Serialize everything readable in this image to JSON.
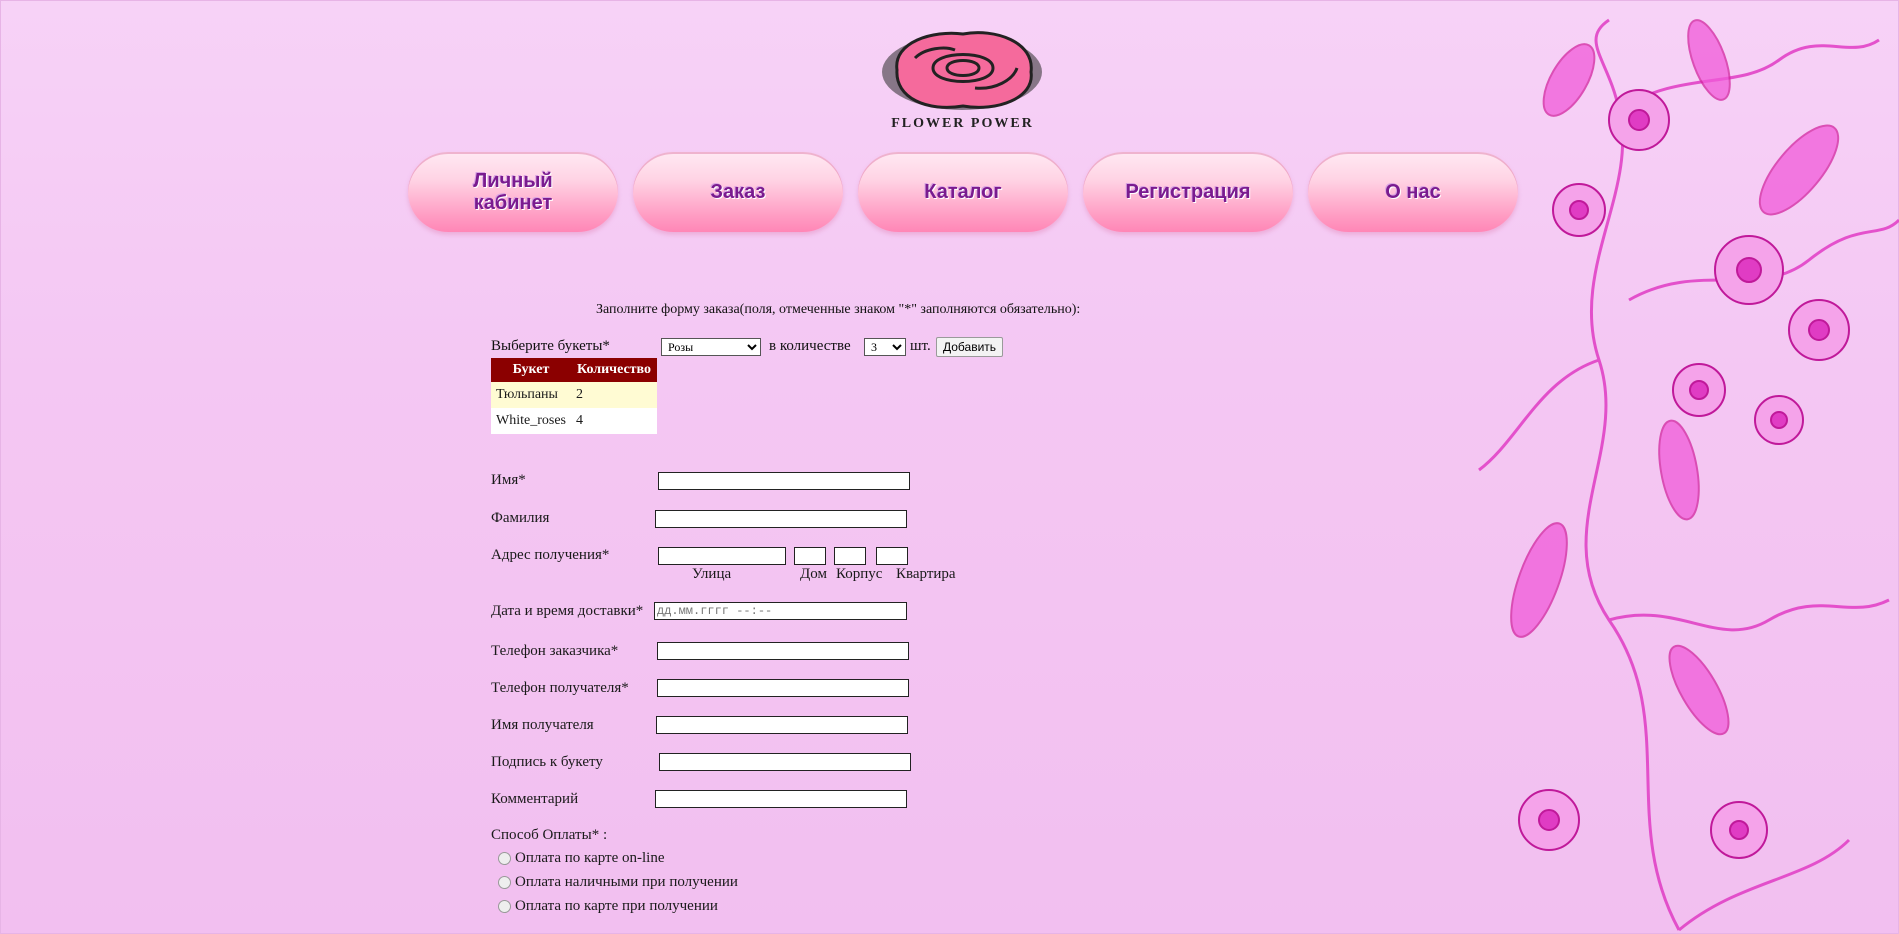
{
  "logo": {
    "text": "FLOWER POWER"
  },
  "nav": [
    {
      "label": "Личный\nкабинет"
    },
    {
      "label": "Заказ"
    },
    {
      "label": "Каталог"
    },
    {
      "label": "Регистрация"
    },
    {
      "label": "О нас"
    }
  ],
  "form": {
    "title": "Заполните форму заказа(поля, отмеченные знаком \"*\" заполняются обязательно):",
    "bouquet_label": "Выберите  букеты*",
    "bouquet_selected": "Розы",
    "quantity_label": "в количестве",
    "quantity_selected": "3",
    "unit_label": "шт.",
    "add_button": "Добавить",
    "table": {
      "headers": [
        "Букет",
        "Количество"
      ],
      "rows": [
        [
          "Тюльпаны",
          "2"
        ],
        [
          "White_roses",
          "4"
        ]
      ]
    },
    "fields": {
      "name": "Имя*",
      "surname": "Фамилия",
      "address": "Адрес получения*",
      "street": "Улица",
      "house": "Дом",
      "building": "Корпус",
      "apartment": "Квартира",
      "delivery": "Дата и время доставки*",
      "delivery_placeholder": "дд.мм.гггг --:--",
      "customer_phone": "Телефон заказчика*",
      "recipient_phone": "Телефон получателя*",
      "recipient_name": "Имя получателя",
      "card_note": "Подпись к букету",
      "comment": "Комментарий"
    },
    "payment": {
      "label": "Способ Оплаты* :",
      "options": [
        "Оплата по карте on-line",
        "Оплата наличными при получении",
        "Оплата по карте при получении"
      ]
    }
  },
  "colors": {
    "table_header": "#8b0000",
    "nav_text": "#7a1b8f",
    "nav_pink": "#ff86b6"
  }
}
